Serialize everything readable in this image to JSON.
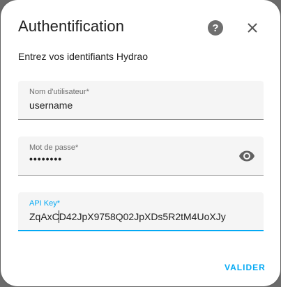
{
  "dialog": {
    "title": "Authentification",
    "subtitle": "Entrez vos identifiants Hydrao",
    "help_icon": "question-circle-icon",
    "close_icon": "close-icon",
    "accent_color": "#03a9f4"
  },
  "fields": {
    "username": {
      "label": "Nom d'utilisateur*",
      "value": "username"
    },
    "password": {
      "label": "Mot de passe*",
      "value": "••••••••",
      "toggle_icon": "eye-icon"
    },
    "api_key": {
      "label": "API Key*",
      "value": "ZqAxCD42JpX9758Q02JpXDs5R2tM4UoXJy"
    }
  },
  "actions": {
    "submit_label": "VALIDER"
  }
}
